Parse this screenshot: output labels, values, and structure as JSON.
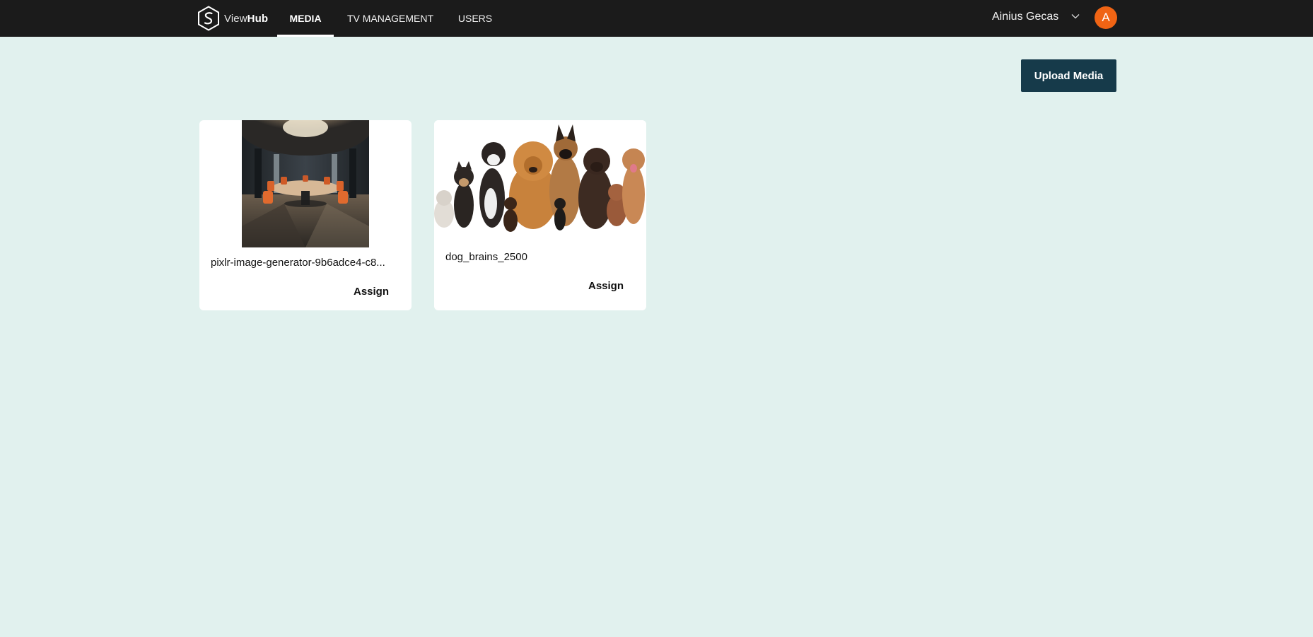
{
  "brand": {
    "prefix": "View",
    "suffix": "Hub"
  },
  "nav": {
    "tabs": [
      {
        "label": "MEDIA",
        "active": true
      },
      {
        "label": "TV MANAGEMENT",
        "active": false
      },
      {
        "label": "USERS",
        "active": false
      }
    ]
  },
  "user": {
    "name": "Ainius Gecas",
    "initial": "A",
    "avatar_color": "#f06414"
  },
  "toolbar": {
    "upload_label": "Upload Media"
  },
  "media": [
    {
      "title": "pixlr-image-generator-9b6adce4-c8...",
      "assign_label": "Assign",
      "thumbnail": "conference-room-image"
    },
    {
      "title": "dog_brains_2500",
      "assign_label": "Assign",
      "thumbnail": "dogs-group-image"
    }
  ],
  "colors": {
    "topbar": "#1b1b1b",
    "background": "#e1f1ee",
    "primary_button": "#163a4a"
  }
}
